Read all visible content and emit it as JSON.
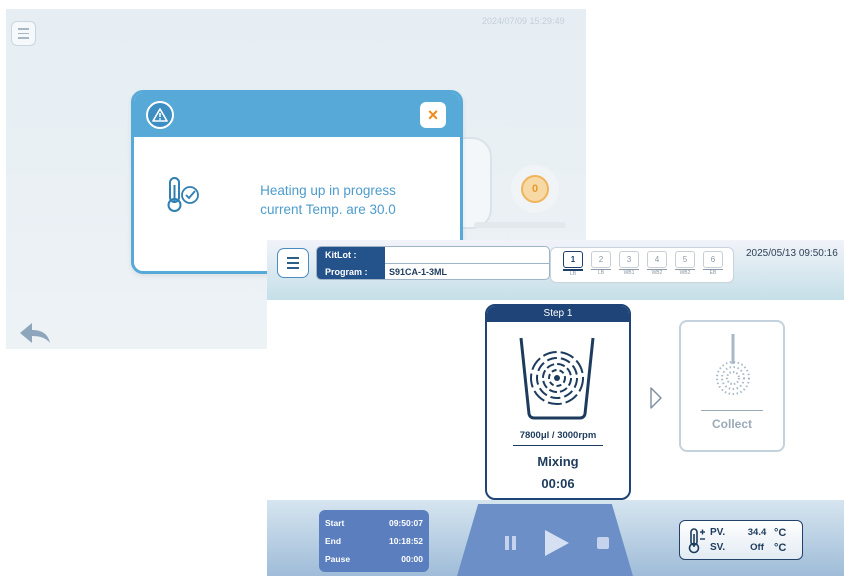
{
  "back_screen": {
    "datetime": "2024/07/09 15:29:49",
    "sync_label": "0"
  },
  "dialog": {
    "message_line1": "Heating up in progress",
    "message_line2": "current Temp. are 30.0",
    "close_label": "×",
    "header_color": "#57a9d8"
  },
  "front_screen": {
    "kitlot_label": "KitLot :",
    "kitlot_value": "",
    "program_label": "Program :",
    "program_value": "S91CA-1-3ML",
    "datetime": "2025/05/13 09:50:16",
    "steps": [
      {
        "num": "1",
        "label": "LB"
      },
      {
        "num": "2",
        "label": "LB"
      },
      {
        "num": "3",
        "label": "WB1"
      },
      {
        "num": "4",
        "label": "WB2"
      },
      {
        "num": "5",
        "label": "WB2"
      },
      {
        "num": "6",
        "label": "EB"
      }
    ],
    "current_step": {
      "title": "Step 1",
      "volume_speed": "7800μl / 3000rpm",
      "name": "Mixing",
      "timer": "00:06"
    },
    "next_step": {
      "name": "Collect"
    },
    "times": {
      "start_label": "Start",
      "start_value": "09:50:07",
      "end_label": "End",
      "end_value": "10:18:52",
      "pause_label": "Pause",
      "pause_value": "00:00"
    },
    "temperature": {
      "pv_label": "PV.",
      "pv_value": "34.4",
      "pv_unit": "°C",
      "sv_label": "SV.",
      "sv_value": "Off",
      "sv_unit": "°C"
    },
    "accent_color": "#1f4477"
  }
}
